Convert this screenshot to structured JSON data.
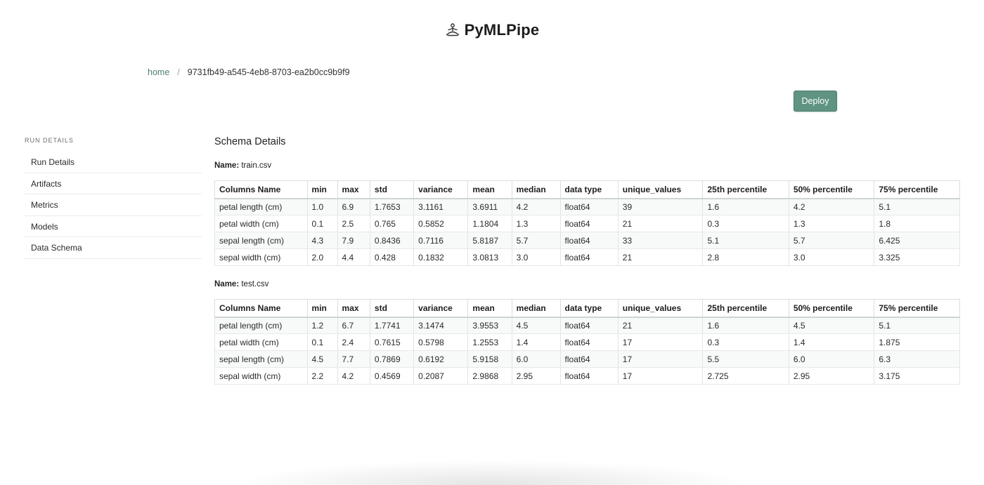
{
  "brand": {
    "title": "PyMLPipe",
    "icon": "meditation-icon"
  },
  "breadcrumb": {
    "home": "home",
    "separator": "/",
    "current": "9731fb49-a545-4eb8-8703-ea2b0cc9b9f9"
  },
  "actions": {
    "deploy_label": "Deploy"
  },
  "colors": {
    "accent": "#5f9382",
    "link": "#4f7f70"
  },
  "sidebar": {
    "heading": "RUN DETAILS",
    "items": [
      {
        "label": "Run Details"
      },
      {
        "label": "Artifacts"
      },
      {
        "label": "Metrics"
      },
      {
        "label": "Models"
      },
      {
        "label": "Data Schema"
      }
    ]
  },
  "main": {
    "title": "Schema Details",
    "name_label": "Name:",
    "columns": [
      "Columns Name",
      "min",
      "max",
      "std",
      "variance",
      "mean",
      "median",
      "data type",
      "unique_values",
      "25th percentile",
      "50% percentile",
      "75% percentile"
    ],
    "schemas": [
      {
        "file": "train.csv",
        "rows": [
          [
            "petal length (cm)",
            "1.0",
            "6.9",
            "1.7653",
            "3.1161",
            "3.6911",
            "4.2",
            "float64",
            "39",
            "1.6",
            "4.2",
            "5.1"
          ],
          [
            "petal width (cm)",
            "0.1",
            "2.5",
            "0.765",
            "0.5852",
            "1.1804",
            "1.3",
            "float64",
            "21",
            "0.3",
            "1.3",
            "1.8"
          ],
          [
            "sepal length (cm)",
            "4.3",
            "7.9",
            "0.8436",
            "0.7116",
            "5.8187",
            "5.7",
            "float64",
            "33",
            "5.1",
            "5.7",
            "6.425"
          ],
          [
            "sepal width (cm)",
            "2.0",
            "4.4",
            "0.428",
            "0.1832",
            "3.0813",
            "3.0",
            "float64",
            "21",
            "2.8",
            "3.0",
            "3.325"
          ]
        ]
      },
      {
        "file": "test.csv",
        "rows": [
          [
            "petal length (cm)",
            "1.2",
            "6.7",
            "1.7741",
            "3.1474",
            "3.9553",
            "4.5",
            "float64",
            "21",
            "1.6",
            "4.5",
            "5.1"
          ],
          [
            "petal width (cm)",
            "0.1",
            "2.4",
            "0.7615",
            "0.5798",
            "1.2553",
            "1.4",
            "float64",
            "17",
            "0.3",
            "1.4",
            "1.875"
          ],
          [
            "sepal length (cm)",
            "4.5",
            "7.7",
            "0.7869",
            "0.6192",
            "5.9158",
            "6.0",
            "float64",
            "17",
            "5.5",
            "6.0",
            "6.3"
          ],
          [
            "sepal width (cm)",
            "2.2",
            "4.2",
            "0.4569",
            "0.2087",
            "2.9868",
            "2.95",
            "float64",
            "17",
            "2.725",
            "2.95",
            "3.175"
          ]
        ]
      }
    ]
  }
}
